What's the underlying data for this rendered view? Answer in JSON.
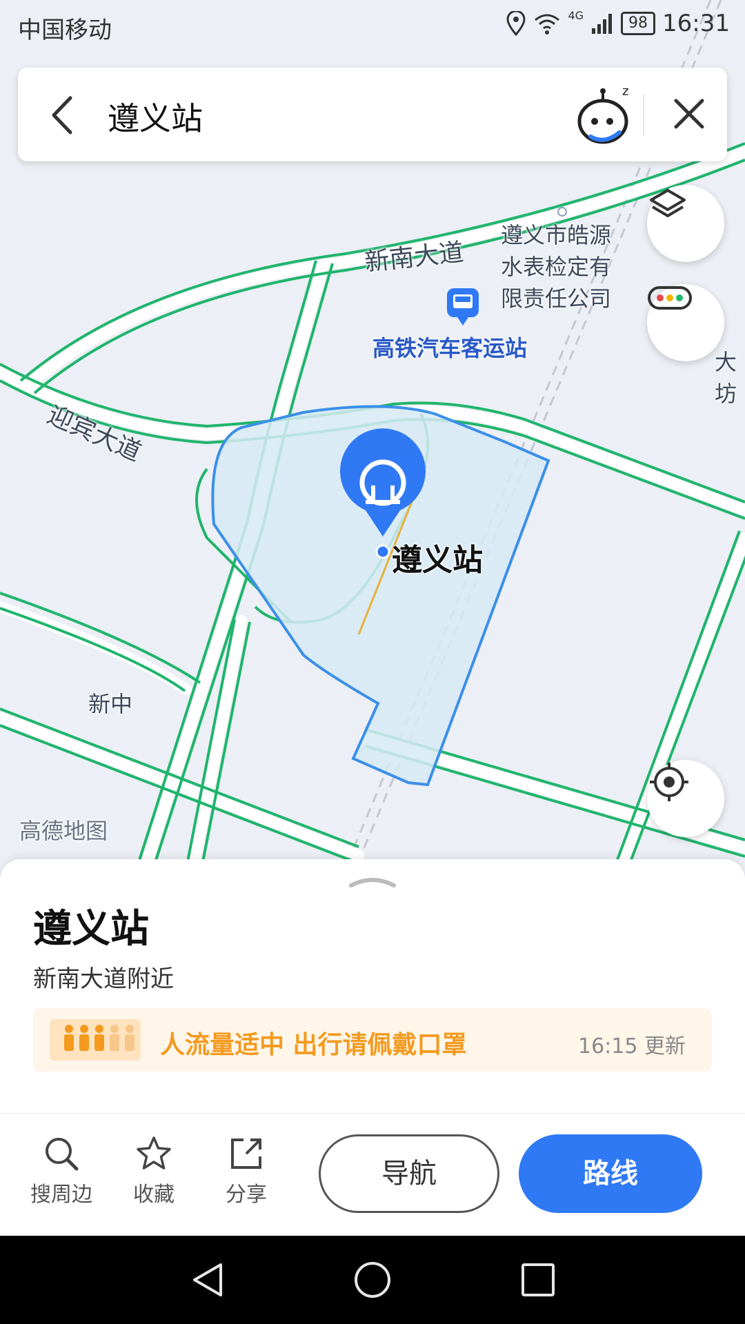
{
  "status_bar": {
    "carrier": "中国移动",
    "battery": "98",
    "time": "16:31",
    "network": "4G"
  },
  "search": {
    "query": "遵义站"
  },
  "map": {
    "labels": {
      "road_north": "新南大道",
      "road_west": "迎宾大道",
      "company": [
        "遵义市皓源",
        "水表检定有",
        "限责任公司"
      ],
      "bus_station": "高铁汽车客运站",
      "station_pin": "遵义站",
      "area": "新中",
      "edge_fragment": "大坊",
      "watermark": "高德地图"
    },
    "controls": [
      "layers-icon",
      "traffic-icon",
      "locate-icon"
    ],
    "colors": {
      "road_outline": "#1fb56c",
      "station_area": "#3b8fe8",
      "pin": "#2f79f5"
    }
  },
  "detail": {
    "title": "遵义站",
    "subtitle": "新南大道附近",
    "crowd_text": "人流量适中 出行请佩戴口罩",
    "crowd_update": "16:15 更新"
  },
  "actions": {
    "search_nearby": "搜周边",
    "favorite": "收藏",
    "share": "分享",
    "navigate": "导航",
    "route": "路线"
  }
}
